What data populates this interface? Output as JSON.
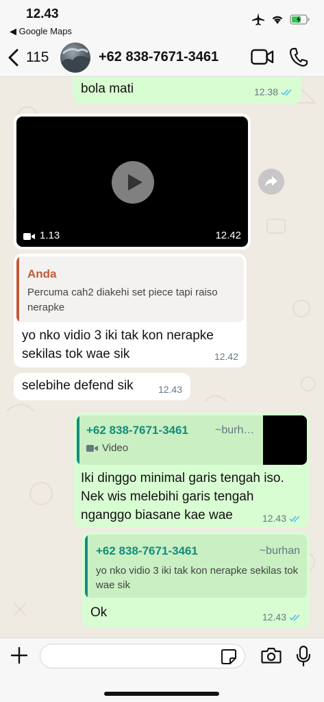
{
  "status_bar": {
    "time": "12.43",
    "back_app": "◀ Google Maps"
  },
  "header": {
    "back_count": "115",
    "contact_name": "+62 838-7671-3461"
  },
  "messages": {
    "m1": {
      "text": "bola mati",
      "time": "12.38"
    },
    "video": {
      "duration": "1.13",
      "time": "12.42"
    },
    "m2": {
      "quote_author": "Anda",
      "quote_text": "Percuma cah2 diakehi set piece tapi raiso nerapke",
      "text": "yo nko vidio 3 iki tak kon nerapke sekilas tok wae sik",
      "time": "12.42"
    },
    "m3": {
      "text": "selebihe defend sik",
      "time": "12.43"
    },
    "m4": {
      "quote_author": "+62 838-7671-3461",
      "quote_alias": "~burh…",
      "quote_type": "Video",
      "text": "Iki dinggo minimal garis tengah iso. Nek wis melebihi garis tengah nganggo biasane kae wae",
      "time": "12.43"
    },
    "m5": {
      "quote_author": "+62 838-7671-3461",
      "quote_alias": "~burhan",
      "quote_text": "yo nko vidio 3 iki tak kon nerapke sekilas tok wae sik",
      "text": "Ok",
      "time": "12.43"
    }
  },
  "composer": {
    "placeholder": ""
  },
  "colors": {
    "out_bubble": "#d9fdd3",
    "in_bubble": "#ffffff",
    "quote_self": "#c15a37",
    "quote_contact": "#128c7e",
    "read_ticks": "#53bdeb"
  }
}
